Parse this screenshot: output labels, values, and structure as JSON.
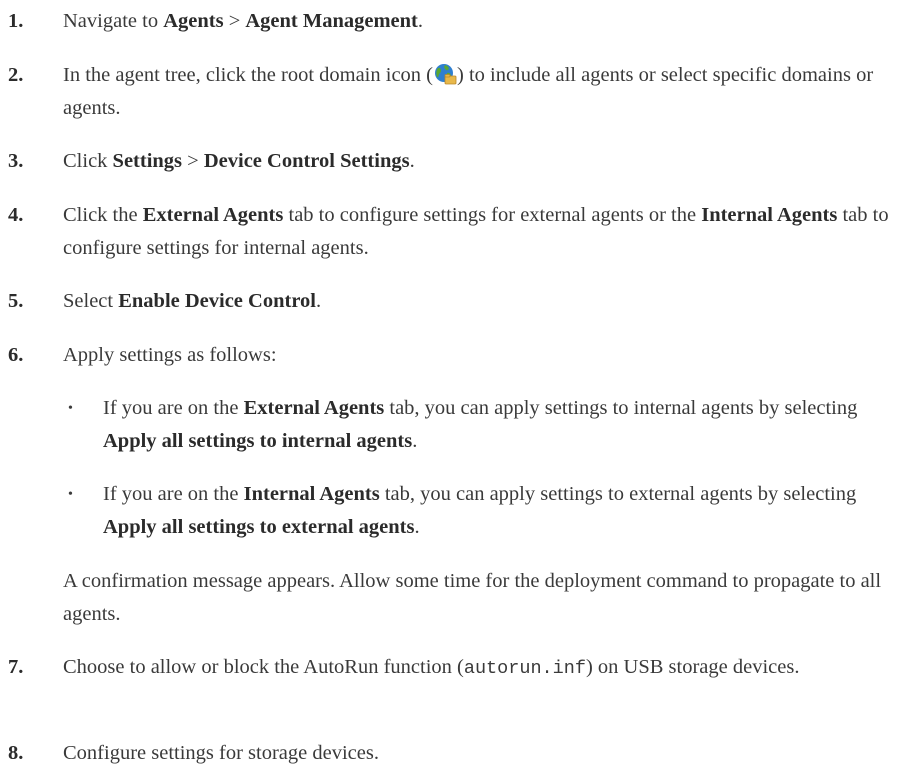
{
  "steps": [
    {
      "num": "1.",
      "text": "Navigate to ",
      "b1": "Agents",
      "sep": " > ",
      "b2": "Agent Management",
      "end": "."
    },
    {
      "num": "2.",
      "text_a": "In the agent tree, click the root domain icon (",
      "text_b": ") to include all agents or select specific domains or agents."
    },
    {
      "num": "3.",
      "text": "Click ",
      "b1": "Settings",
      "sep": " > ",
      "b2": "Device Control Settings",
      "end": "."
    },
    {
      "num": "4.",
      "text": "Click the ",
      "b1": "External Agents",
      "mid": " tab to configure settings for external agents or the ",
      "b2": "Internal Agents",
      "end": " tab to configure settings for internal agents."
    },
    {
      "num": "5.",
      "text": "Select ",
      "b1": "Enable Device Control",
      "end": "."
    },
    {
      "num": "6.",
      "text": "Apply settings as follows:"
    },
    {
      "num": "7.",
      "text_a": "Choose to allow or block the AutoRun function (",
      "code": "autorun.inf",
      "text_b": ") on USB storage devices."
    },
    {
      "num": "8.",
      "text": "Configure settings for storage devices."
    }
  ],
  "bullets": [
    {
      "mark": "•",
      "a": "If you are on the ",
      "b1": "External Agents",
      "c": " tab, you can apply settings to internal agents by selecting ",
      "b2": "Apply all settings to internal agents",
      "end": "."
    },
    {
      "mark": "•",
      "a": "If you are on the ",
      "b1": "Internal Agents",
      "c": " tab, you can apply settings to external agents by selecting ",
      "b2": "Apply all settings to external agents",
      "end": "."
    }
  ],
  "confirmation": "A confirmation message appears. Allow some time for the deployment command to propagate to all agents.",
  "icons": {
    "root_domain": "globe-folder-icon"
  },
  "colors": {
    "text": "#3a3a3a",
    "bold": "#2b2b2b",
    "globe_blue": "#2f7fd0",
    "globe_green": "#5aa832",
    "folder": "#e8b84a"
  }
}
